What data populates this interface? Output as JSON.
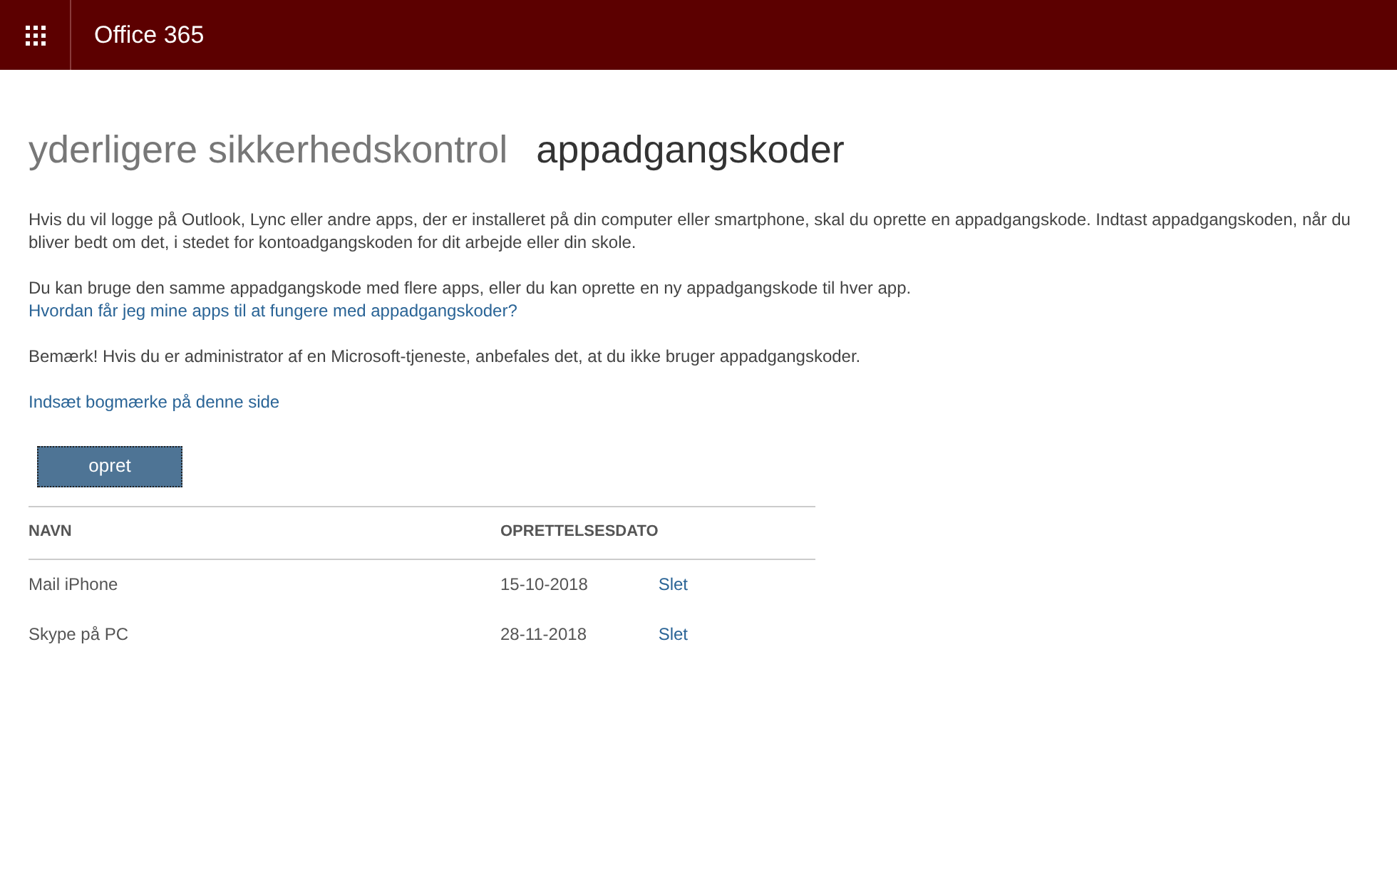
{
  "header": {
    "title": "Office 365"
  },
  "heading": {
    "section": "yderligere sikkerhedskontrol",
    "page": "appadgangskoder"
  },
  "paragraphs": [
    {
      "text": "Hvis du vil logge på Outlook, Lync eller andre apps, der er installeret på din computer eller smartphone, skal du oprette en appadgangskode. Indtast appadgangskoden, når du bliver bedt om det, i stedet for kontoadgangskoden for dit arbejde eller din skole."
    },
    {
      "text": "Du kan bruge den samme appadgangskode med flere apps, eller du kan oprette en ny appadgangskode til hver app.",
      "link": "Hvordan får jeg mine apps til at fungere med appadgangskoder?"
    },
    {
      "text": "Bemærk! Hvis du er administrator af en Microsoft-tjeneste, anbefales det, at du ikke bruger appadgangskoder."
    }
  ],
  "bookmark_link": "Indsæt bogmærke på denne side",
  "create_button": "opret",
  "table": {
    "columns": [
      "NAVN",
      "OPRETTELSESDATO"
    ],
    "rows": [
      {
        "name": "Mail iPhone",
        "date": "15-10-2018",
        "action": "Slet"
      },
      {
        "name": "Skype på PC",
        "date": "28-11-2018",
        "action": "Slet"
      }
    ]
  }
}
